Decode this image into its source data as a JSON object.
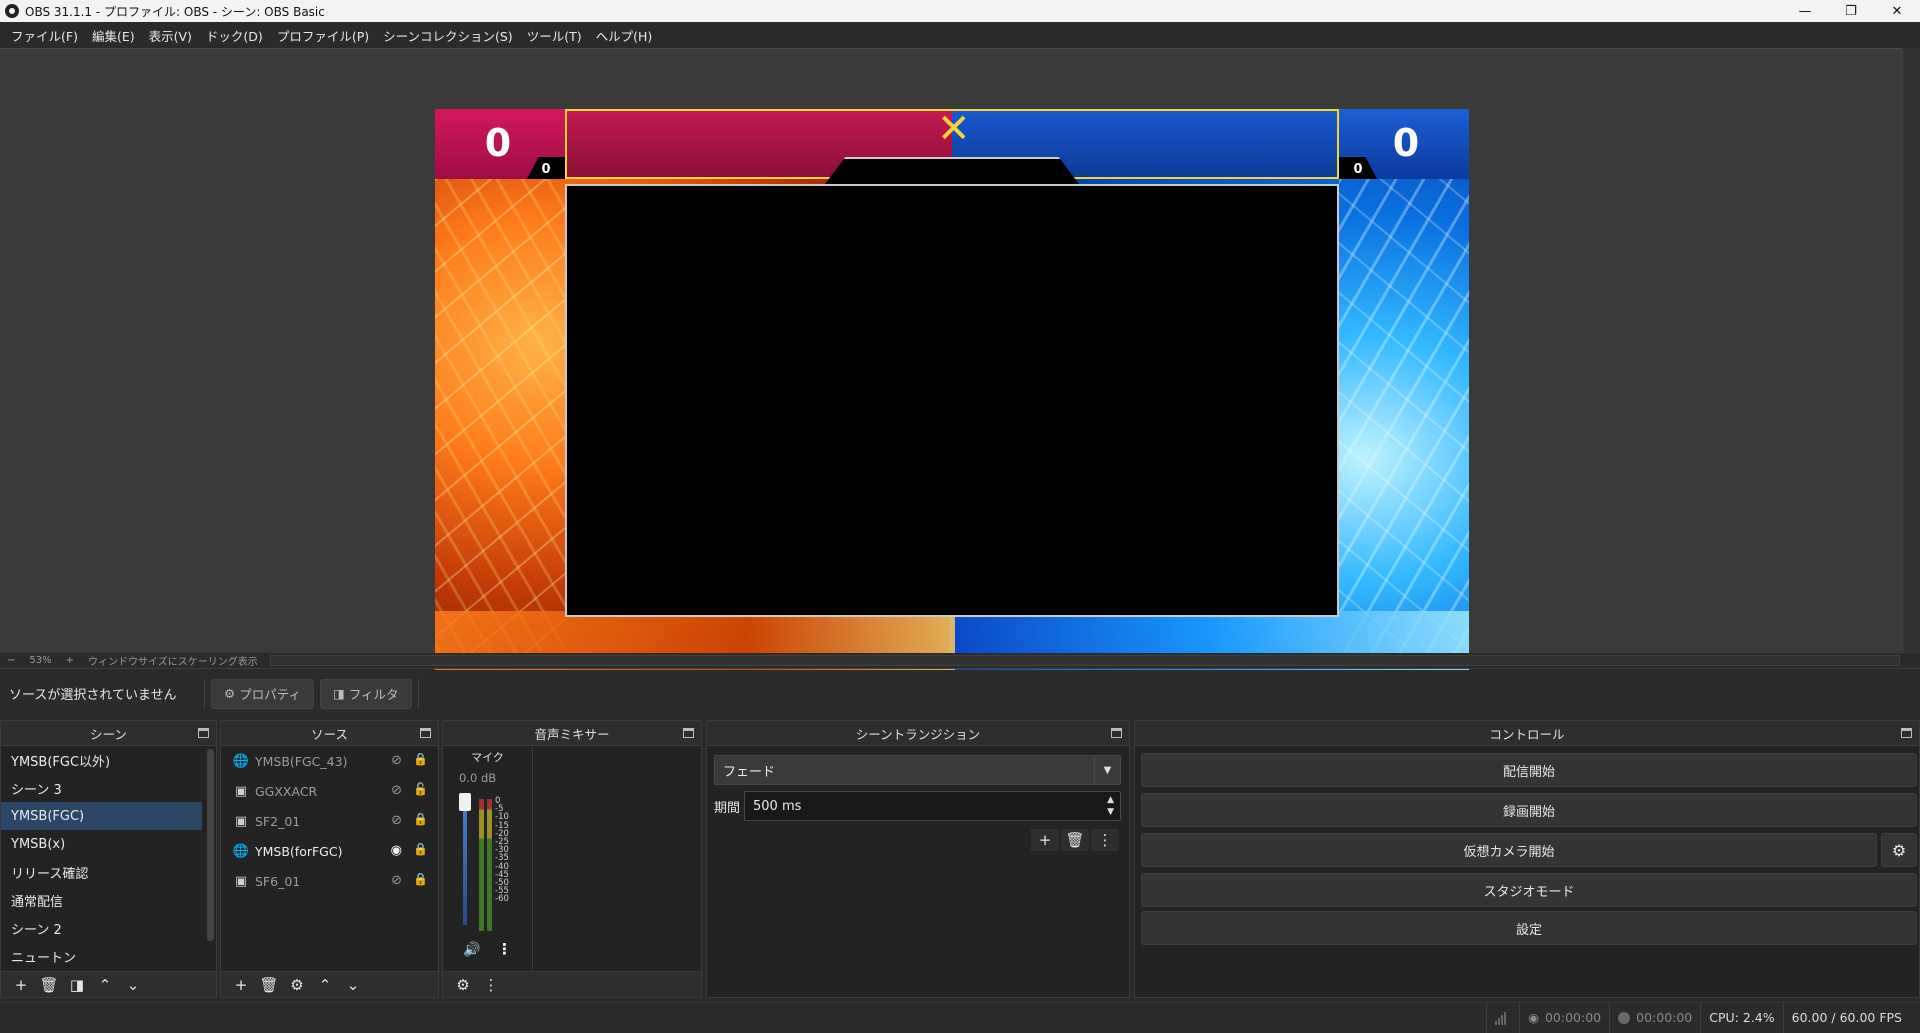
{
  "window": {
    "title": "OBS 31.1.1 - プロファイル: OBS - シーン: OBS Basic",
    "minimize_icon": "minimize-icon",
    "maximize_icon": "maximize-icon",
    "close_icon": "close-icon"
  },
  "menu": [
    {
      "label": "ファイル(F)"
    },
    {
      "label": "編集(E)"
    },
    {
      "label": "表示(V)"
    },
    {
      "label": "ドック(D)"
    },
    {
      "label": "プロファイル(P)"
    },
    {
      "label": "シーンコレクション(S)"
    },
    {
      "label": "ツール(T)"
    },
    {
      "label": "ヘルプ(H)"
    }
  ],
  "preview": {
    "score_left": "0",
    "score_right": "0",
    "mini_left": "0",
    "mini_right": "0",
    "colors": {
      "left_team": "#c41a52",
      "right_team": "#1b58cf",
      "frame_border": "#f3d43a"
    }
  },
  "zoombar": {
    "minus": "−",
    "zoom": "53%",
    "plus": "+",
    "mode": "ウィンドウサイズにスケーリング表示"
  },
  "selection": {
    "no_source": "ソースが選択されていません",
    "properties_button": "プロパティ",
    "filters_button": "フィルタ"
  },
  "scenes": {
    "title": "シーン",
    "items": [
      {
        "label": "YMSB(FGC以外)"
      },
      {
        "label": "シーン 3"
      },
      {
        "label": "YMSB(FGC)"
      },
      {
        "label": "YMSB(x)"
      },
      {
        "label": "リリース確認"
      },
      {
        "label": "通常配信"
      },
      {
        "label": "シーン 2"
      },
      {
        "label": "ニュートン"
      }
    ],
    "active_index": 2
  },
  "sources": {
    "title": "ソース",
    "items": [
      {
        "label": "YMSB(FGC_43)",
        "icon": "browser-icon",
        "visible": false
      },
      {
        "label": "GGXXACR",
        "icon": "image-icon",
        "visible": false
      },
      {
        "label": "SF2_01",
        "icon": "image-icon",
        "visible": false
      },
      {
        "label": "YMSB(forFGC)",
        "icon": "browser-icon",
        "visible": true
      },
      {
        "label": "SF6_01",
        "icon": "image-icon",
        "visible": false
      }
    ]
  },
  "mixer": {
    "title": "音声ミキサー",
    "channel_name": "マイク",
    "channel_db": "0.0 dB",
    "ticks": [
      "0",
      "-5",
      "-10",
      "-15",
      "-20",
      "-25",
      "-30",
      "-35",
      "-40",
      "-45",
      "-50",
      "-55",
      "-60"
    ]
  },
  "transitions": {
    "title": "シーントランジション",
    "selected": "フェード",
    "duration_label": "期間",
    "duration_value": "500 ms"
  },
  "controls": {
    "title": "コントロール",
    "start_streaming": "配信開始",
    "start_recording": "録画開始",
    "start_virtual_camera": "仮想カメラ開始",
    "studio_mode": "スタジオモード",
    "settings": "設定"
  },
  "status": {
    "stream_time": "00:00:00",
    "record_time": "00:00:00",
    "cpu": "CPU: 2.4%",
    "fps": "60.00 / 60.00 FPS"
  }
}
